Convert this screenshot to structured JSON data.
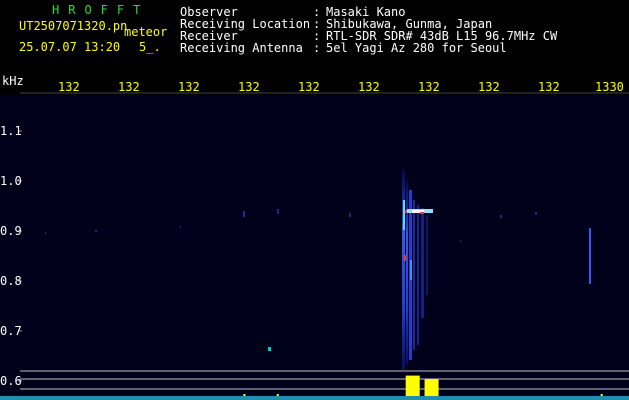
{
  "app": {
    "name": "HROFFT",
    "filename": "UT2507071320.pn",
    "suffix": "meteor",
    "datetime": "25.07.07 13:20",
    "timer": "5_."
  },
  "info": [
    {
      "label": "Observer",
      "value": "Masaki Kano"
    },
    {
      "label": "Receiving Location",
      "value": "Shibukawa, Gunma, Japan"
    },
    {
      "label": "Receiver",
      "value": "RTL-SDR SDR# 43dB L15 96.7MHz CW"
    },
    {
      "label": "Receiving Antenna",
      "value": "5el Yagi Az 280 for Seoul"
    }
  ],
  "chart_data": {
    "type": "heatmap",
    "x_unit_label": "kHz",
    "x_tick_labels": [
      "132",
      "132",
      "132",
      "132",
      "132",
      "132",
      "132",
      "132",
      "132",
      "1330"
    ],
    "y_tick_labels": [
      "1.1",
      "1.0",
      "0.9",
      "0.8",
      "0.7",
      "0.6"
    ],
    "yellow_bars": [
      {
        "x_fraction": 0.387,
        "level": 0.06
      },
      {
        "x_fraction": 0.44,
        "level": 0.05
      },
      {
        "x_fraction": 0.645,
        "level": 0.85
      },
      {
        "x_fraction": 0.675,
        "level": 0.7
      },
      {
        "x_fraction": 0.955,
        "level": 0.05
      }
    ]
  },
  "colors": {
    "background": "#000000",
    "spectrogram_bg": "#00001a",
    "text_main": "#ffffff",
    "text_accent": "#ffff00",
    "title": "#22e022",
    "signal_blue": "#2a4dff",
    "signal_cyan": "#00ffff",
    "signal_hot": "#ff3030",
    "level_bar": "#ffff00"
  }
}
